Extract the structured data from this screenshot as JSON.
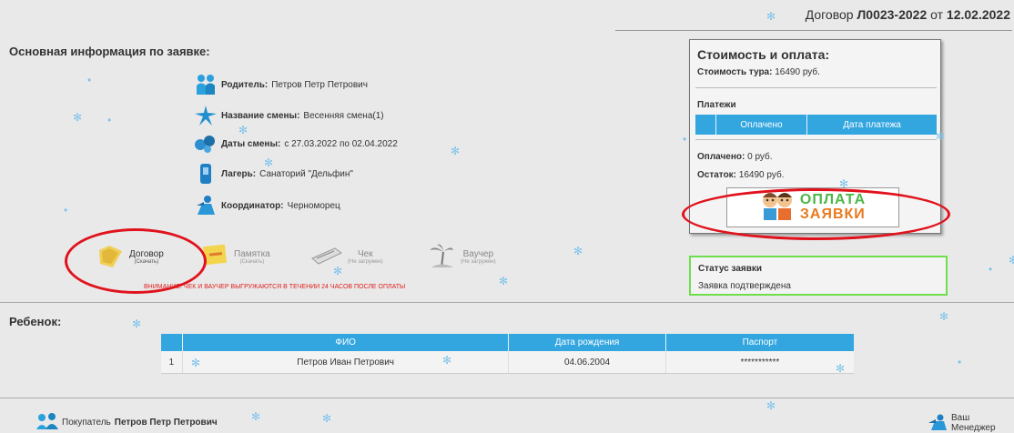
{
  "header": {
    "contract_prefix": "Договор ",
    "contract_number": "Л0023-2022",
    "contract_mid": " от ",
    "contract_date": "12.02.2022"
  },
  "main": {
    "title": "Основная информация по заявке:",
    "rows": [
      {
        "label": "Родитель:",
        "value": "Петров Петр Петрович",
        "icon": "parents-icon"
      },
      {
        "label": "Название смены:",
        "value": "Весенняя смена(1)",
        "icon": "star-icon"
      },
      {
        "label": "Даты смены:",
        "value": "с 27.03.2022 по 02.04.2022",
        "icon": "calendar-icon"
      },
      {
        "label": "Лагерь:",
        "value": "Санаторий \"Дельфин\"",
        "icon": "camp-icon"
      },
      {
        "label": "Координатор:",
        "value": "Черноморец",
        "icon": "coordinator-icon"
      }
    ]
  },
  "documents": [
    {
      "name": "Договор",
      "status": "(Скачать)"
    },
    {
      "name": "Памятка",
      "status": "(Скачать)"
    },
    {
      "name": "Чек",
      "status": "(Не загружен)"
    },
    {
      "name": "Ваучер",
      "status": "(Не загружен)"
    }
  ],
  "warning": "ВНИМАНИЕ: ЧЕК И ВАУЧЕР ВЫГРУЖАЮТСЯ В ТЕЧЕНИИ 24 ЧАСОВ ПОСЛЕ ОПЛАТЫ",
  "cost": {
    "title": "Стоимость и оплата:",
    "tour_label": "Стоимость тура:",
    "tour_value": "16490 руб.",
    "payments_label": "Платежи",
    "cols": [
      "",
      "Оплачено",
      "Дата платежа"
    ],
    "paid_label": "Оплачено:",
    "paid_value": "0 руб.",
    "rest_label": "Остаток:",
    "rest_value": "16490 руб.",
    "pay_line1": "ОПЛАТА",
    "pay_line2": "ЗАЯВКИ"
  },
  "status": {
    "title": "Статус заявки",
    "value": "Заявка подтверждена"
  },
  "child": {
    "title": "Ребенок:",
    "columns": [
      "",
      "ФИО",
      "Дата рождения",
      "Паспорт"
    ],
    "rows": [
      {
        "n": "1",
        "name": "Петров Иван Петрович",
        "birth": "04.06.2004",
        "passport": "***********"
      }
    ]
  },
  "footer": {
    "buyer_label": "Покупатель",
    "buyer_name": "Петров Петр Петрович",
    "manager": "Ваш Менеджер"
  },
  "colors": {
    "accent": "#33a6e0",
    "highlight": "#e0121c",
    "status_border": "#6ede4c"
  }
}
